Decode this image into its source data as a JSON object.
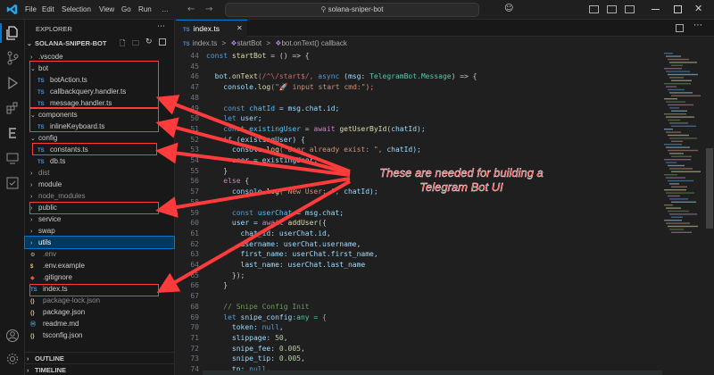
{
  "menu": [
    "File",
    "Edit",
    "Selection",
    "View",
    "Go",
    "Run",
    "…"
  ],
  "search": {
    "text": "solana-sniper-bot"
  },
  "explorer": {
    "title": "EXPLORER",
    "project": "SOLANA-SNIPER-BOT",
    "outline": "OUTLINE",
    "timeline": "TIMELINE"
  },
  "tree": [
    {
      "label": ".vscode",
      "kind": "folder",
      "open": false,
      "indent": 0,
      "color": "#cccccc"
    },
    {
      "label": "bot",
      "kind": "folder",
      "open": true,
      "indent": 0,
      "color": "#cccccc"
    },
    {
      "label": "botAction.ts",
      "kind": "ts",
      "indent": 1,
      "color": "#cccccc"
    },
    {
      "label": "callbackquery.handler.ts",
      "kind": "ts",
      "indent": 1,
      "color": "#cccccc"
    },
    {
      "label": "message.handler.ts",
      "kind": "ts",
      "indent": 1,
      "color": "#cccccc"
    },
    {
      "label": "components",
      "kind": "folder",
      "open": true,
      "indent": 0,
      "color": "#cccccc"
    },
    {
      "label": "inlineKeyboard.ts",
      "kind": "ts",
      "indent": 1,
      "color": "#cccccc"
    },
    {
      "label": "config",
      "kind": "folder",
      "open": true,
      "indent": 0,
      "color": "#cccccc"
    },
    {
      "label": "constants.ts",
      "kind": "ts",
      "indent": 1,
      "color": "#cccccc"
    },
    {
      "label": "db.ts",
      "kind": "ts",
      "indent": 1,
      "color": "#cccccc"
    },
    {
      "label": "dist",
      "kind": "folder",
      "open": false,
      "indent": 0,
      "color": "#8b8b8b"
    },
    {
      "label": "module",
      "kind": "folder",
      "open": false,
      "indent": 0,
      "color": "#cccccc"
    },
    {
      "label": "node_modules",
      "kind": "folder",
      "open": false,
      "indent": 0,
      "color": "#8b8b8b"
    },
    {
      "label": "public",
      "kind": "folder",
      "open": false,
      "indent": 0,
      "color": "#cccccc"
    },
    {
      "label": "service",
      "kind": "folder",
      "open": false,
      "indent": 0,
      "color": "#cccccc"
    },
    {
      "label": "swap",
      "kind": "folder",
      "open": false,
      "indent": 0,
      "color": "#cccccc"
    },
    {
      "label": "utils",
      "kind": "folder",
      "open": false,
      "indent": 0,
      "color": "#ffffff",
      "selected": true
    },
    {
      "label": ".env",
      "kind": "env",
      "indent": 0,
      "color": "#8b8b8b"
    },
    {
      "label": ".env.example",
      "kind": "dollar",
      "indent": 0,
      "color": "#cccccc"
    },
    {
      "label": ".gitignore",
      "kind": "git",
      "indent": 0,
      "color": "#cccccc"
    },
    {
      "label": "index.ts",
      "kind": "ts",
      "indent": 0,
      "color": "#cccccc"
    },
    {
      "label": "package-lock.json",
      "kind": "json",
      "indent": 0,
      "color": "#8b8b8b"
    },
    {
      "label": "package.json",
      "kind": "json",
      "indent": 0,
      "color": "#cccccc"
    },
    {
      "label": "readme.md",
      "kind": "md",
      "indent": 0,
      "color": "#cccccc"
    },
    {
      "label": "tsconfig.json",
      "kind": "json",
      "indent": 0,
      "color": "#cccccc"
    }
  ],
  "tab": {
    "label": "index.ts",
    "badge": "TS"
  },
  "breadcrumb": {
    "file": "index.ts",
    "sep": ">",
    "item1": "startBot",
    "item2": "bot.onText() callback"
  },
  "code": [
    {
      "n": "44",
      "t": [
        [
          "const ",
          "#569cd6"
        ],
        [
          "startBot",
          "#dcdcaa"
        ],
        [
          " = () => {",
          "#cccccc"
        ]
      ]
    },
    {
      "n": "45",
      "t": [
        [
          "",
          "#cccccc"
        ]
      ]
    },
    {
      "n": "46",
      "t": [
        [
          "  bot.",
          "#9cdcfe"
        ],
        [
          "onText",
          "#dcdcaa"
        ],
        [
          "(/^\\/start$/, ",
          "#d16969"
        ],
        [
          "async ",
          "#569cd6"
        ],
        [
          "(msg: ",
          "#9cdcfe"
        ],
        [
          "TelegramBot.Message",
          "#4ec9b0"
        ],
        [
          ") => {",
          "#cccccc"
        ]
      ]
    },
    {
      "n": "47",
      "t": [
        [
          "    console.",
          "#9cdcfe"
        ],
        [
          "log",
          "#dcdcaa"
        ],
        [
          "(\"🚀 input start cmd:\");",
          "#ce9178"
        ]
      ]
    },
    {
      "n": "48",
      "t": [
        [
          "",
          "#cccccc"
        ]
      ]
    },
    {
      "n": "49",
      "t": [
        [
          "    const ",
          "#569cd6"
        ],
        [
          "chatId",
          "#4fc1ff"
        ],
        [
          " = msg.chat.id;",
          "#9cdcfe"
        ]
      ]
    },
    {
      "n": "50",
      "t": [
        [
          "    let ",
          "#569cd6"
        ],
        [
          "user;",
          "#9cdcfe"
        ]
      ]
    },
    {
      "n": "51",
      "t": [
        [
          "    const ",
          "#569cd6"
        ],
        [
          "existingUser",
          "#4fc1ff"
        ],
        [
          " = ",
          "#cccccc"
        ],
        [
          "await ",
          "#c586c0"
        ],
        [
          "getUserById",
          "#dcdcaa"
        ],
        [
          "(chatId);",
          "#9cdcfe"
        ]
      ]
    },
    {
      "n": "52",
      "t": [
        [
          "    if ",
          "#c586c0"
        ],
        [
          "(existingUser) {",
          "#9cdcfe"
        ]
      ]
    },
    {
      "n": "53",
      "t": [
        [
          "      console.",
          "#9cdcfe"
        ],
        [
          "log",
          "#dcdcaa"
        ],
        [
          "(\"User already exist: \", ",
          "#ce9178"
        ],
        [
          "chatId);",
          "#9cdcfe"
        ]
      ]
    },
    {
      "n": "54",
      "t": [
        [
          "      user = existingUser;",
          "#9cdcfe"
        ]
      ]
    },
    {
      "n": "55",
      "t": [
        [
          "    }",
          "#cccccc"
        ]
      ]
    },
    {
      "n": "56",
      "t": [
        [
          "    else ",
          "#c586c0"
        ],
        [
          "{",
          "#cccccc"
        ]
      ]
    },
    {
      "n": "57",
      "t": [
        [
          "      console.",
          "#9cdcfe"
        ],
        [
          "log",
          "#dcdcaa"
        ],
        [
          "(\"New User: \", ",
          "#ce9178"
        ],
        [
          "chatId);",
          "#9cdcfe"
        ]
      ]
    },
    {
      "n": "58",
      "t": [
        [
          "",
          "#cccccc"
        ]
      ]
    },
    {
      "n": "59",
      "t": [
        [
          "      const ",
          "#569cd6"
        ],
        [
          "userChat",
          "#4fc1ff"
        ],
        [
          " = msg.chat;",
          "#9cdcfe"
        ]
      ]
    },
    {
      "n": "60",
      "t": [
        [
          "      user = ",
          "#9cdcfe"
        ],
        [
          "await ",
          "#c586c0"
        ],
        [
          "addUser",
          "#dcdcaa"
        ],
        [
          "({",
          "#cccccc"
        ]
      ]
    },
    {
      "n": "61",
      "t": [
        [
          "        chat_id: userChat.id,",
          "#9cdcfe"
        ]
      ]
    },
    {
      "n": "62",
      "t": [
        [
          "        username: userChat.username,",
          "#9cdcfe"
        ]
      ]
    },
    {
      "n": "63",
      "t": [
        [
          "        first_name: userChat.first_name,",
          "#9cdcfe"
        ]
      ]
    },
    {
      "n": "64",
      "t": [
        [
          "        last_name: userChat.last_name",
          "#9cdcfe"
        ]
      ]
    },
    {
      "n": "65",
      "t": [
        [
          "      });",
          "#cccccc"
        ]
      ]
    },
    {
      "n": "66",
      "t": [
        [
          "    }",
          "#cccccc"
        ]
      ]
    },
    {
      "n": "67",
      "t": [
        [
          "",
          "#cccccc"
        ]
      ]
    },
    {
      "n": "68",
      "t": [
        [
          "    // Snipe Config Init",
          "#6a9955"
        ]
      ]
    },
    {
      "n": "69",
      "t": [
        [
          "    let ",
          "#569cd6"
        ],
        [
          "snipe_config",
          "#9cdcfe"
        ],
        [
          ":any = {",
          "#4ec9b0"
        ]
      ]
    },
    {
      "n": "70",
      "t": [
        [
          "      token: ",
          "#9cdcfe"
        ],
        [
          "null",
          "#569cd6"
        ],
        [
          ",",
          "#cccccc"
        ]
      ]
    },
    {
      "n": "71",
      "t": [
        [
          "      slippage: ",
          "#9cdcfe"
        ],
        [
          "50",
          "#b5cea8"
        ],
        [
          ",",
          "#cccccc"
        ]
      ]
    },
    {
      "n": "72",
      "t": [
        [
          "      snipe_fee: ",
          "#9cdcfe"
        ],
        [
          "0.005",
          "#b5cea8"
        ],
        [
          ",",
          "#cccccc"
        ]
      ]
    },
    {
      "n": "73",
      "t": [
        [
          "      snipe_tip: ",
          "#9cdcfe"
        ],
        [
          "0.005",
          "#b5cea8"
        ],
        [
          ",",
          "#cccccc"
        ]
      ]
    },
    {
      "n": "74",
      "t": [
        [
          "      tp: ",
          "#9cdcfe"
        ],
        [
          "null",
          "#569cd6"
        ],
        [
          ",",
          "#cccccc"
        ]
      ]
    },
    {
      "n": "75",
      "t": [
        [
          "      sl: ",
          "#9cdcfe"
        ],
        [
          "null",
          "#569cd6"
        ],
        [
          ",",
          "#cccccc"
        ]
      ]
    },
    {
      "n": "76",
      "t": [
        [
          "      snipe_amount: null",
          "#9cdcfe"
        ]
      ]
    }
  ],
  "annotation": {
    "text": "These are needed for building a Telegram Bot UI",
    "color": "#ff2a2a"
  },
  "colors": {
    "accent": "#0078d4",
    "arrow": "#ff3b3b",
    "ts_icon": "#4a90d9"
  }
}
